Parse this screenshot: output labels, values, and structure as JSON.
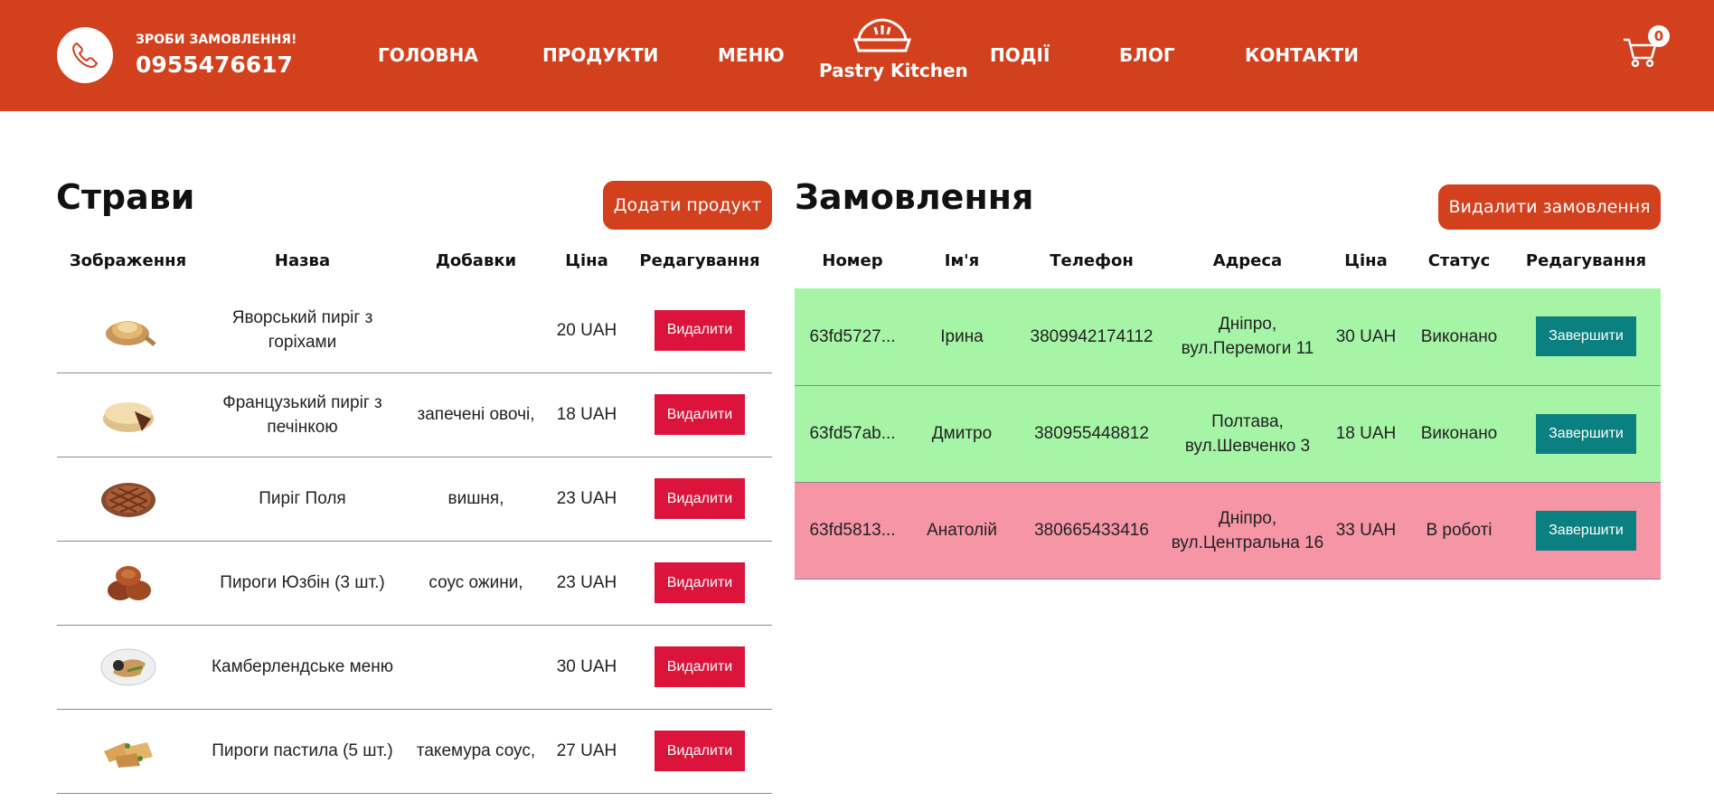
{
  "header": {
    "order_prompt": "ЗРОБИ ЗАМОВЛЕННЯ!",
    "phone": "0955476617",
    "nav": [
      "ГОЛОВНА",
      "ПРОДУКТИ",
      "МЕНЮ",
      "ПОДІЇ",
      "БЛОГ",
      "КОНТАКТИ"
    ],
    "logo_text": "Pastry Kitchen",
    "cart_count": "0",
    "bg_color": "#d2401e"
  },
  "products": {
    "title": "Страви",
    "add_button": "Додати продукт",
    "columns": [
      "Зображення",
      "Назва",
      "Добавки",
      "Ціна",
      "Редагування"
    ],
    "rows": [
      {
        "name": "Яворський пиріг з горіхами",
        "extras": "",
        "price": "20 UAH",
        "action": "Видалити",
        "image": "round-pie-on-board"
      },
      {
        "name": "Французький пиріг з печінкою",
        "extras": "запечені овочі,",
        "price": "18 UAH",
        "action": "Видалити",
        "image": "sliced-pie"
      },
      {
        "name": "Пиріг Поля",
        "extras": "вишня,",
        "price": "23 UAH",
        "action": "Видалити",
        "image": "lattice-pie"
      },
      {
        "name": "Пироги Юзбін (3 шт.)",
        "extras": "соус ожини,",
        "price": "23 UAH",
        "action": "Видалити",
        "image": "stacked-pies"
      },
      {
        "name": "Камберлендське меню",
        "extras": "",
        "price": "30 UAH",
        "action": "Видалити",
        "image": "plated-dish"
      },
      {
        "name": "Пироги пастила (5 шт.)",
        "extras": "такемура соус,",
        "price": "27 UAH",
        "action": "Видалити",
        "image": "pastry-rolls"
      }
    ],
    "delete_color": "#dc143c"
  },
  "orders": {
    "title": "Замовлення",
    "delete_button": "Видалити замовлення",
    "columns": [
      "Номер",
      "Ім'я",
      "Телефон",
      "Адреса",
      "Ціна",
      "Статус",
      "Редагування"
    ],
    "rows": [
      {
        "number": "63fd5727...",
        "name": "Ірина",
        "phone": "3809942174112",
        "address": "Дніпро, вул.Перемоги 11",
        "price": "30 UAH",
        "status": "Виконано",
        "action": "Завершити",
        "state": "done"
      },
      {
        "number": "63fd57ab...",
        "name": "Дмитро",
        "phone": "380955448812",
        "address": "Полтава, вул.Шевченко 3",
        "price": "18 UAH",
        "status": "Виконано",
        "action": "Завершити",
        "state": "done"
      },
      {
        "number": "63fd5813...",
        "name": "Анатолій",
        "phone": "380665433416",
        "address": "Дніпро, вул.Центральна 16",
        "price": "33 UAH",
        "status": "В роботі",
        "action": "Завершити",
        "state": "work"
      }
    ],
    "done_color": "#a6f5a6",
    "work_color": "#f595a6",
    "finish_color": "#0b8080"
  }
}
